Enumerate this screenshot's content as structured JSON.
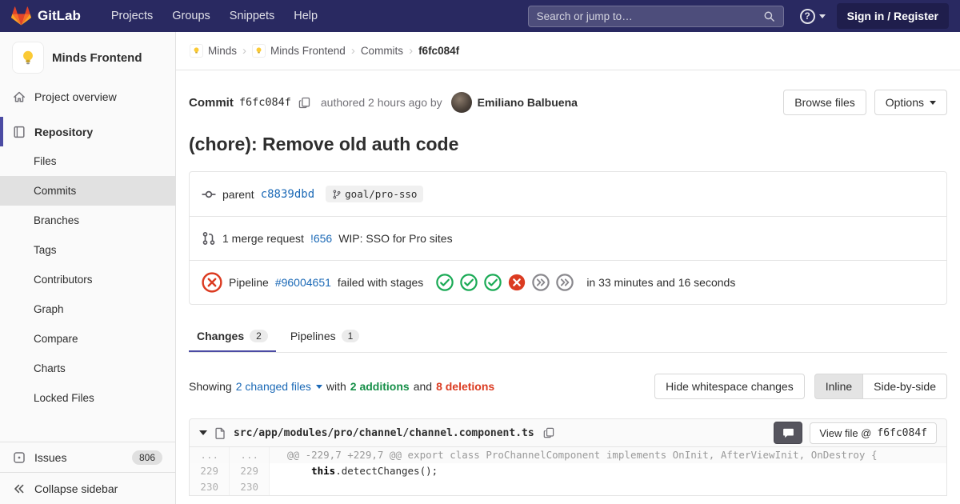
{
  "navbar": {
    "brand": "GitLab",
    "menu": [
      "Projects",
      "Groups",
      "Snippets",
      "Help"
    ],
    "search_placeholder": "Search or jump to…",
    "help_glyph": "?",
    "sign_in": "Sign in / Register"
  },
  "sidebar": {
    "project_name": "Minds Frontend",
    "avatar_icon": "lightbulb-icon",
    "overview": "Project overview",
    "section_label": "Repository",
    "items": [
      "Files",
      "Commits",
      "Branches",
      "Tags",
      "Contributors",
      "Graph",
      "Compare",
      "Charts",
      "Locked Files"
    ],
    "active_item": "Commits",
    "issues_label": "Issues",
    "issues_count": "806",
    "collapse_label": "Collapse sidebar"
  },
  "breadcrumb": {
    "group": "Minds",
    "project": "Minds Frontend",
    "section": "Commits",
    "current": "f6fc084f"
  },
  "commit": {
    "label": "Commit",
    "sha": "f6fc084f",
    "authored": "authored 2 hours ago by",
    "author": "Emiliano Balbuena",
    "browse_files": "Browse files",
    "options": "Options",
    "title": "(chore): Remove old auth code"
  },
  "details": {
    "parent_label": "parent",
    "parent_sha": "c8839dbd",
    "ref": "goal/pro-sso",
    "mr_count": "1 merge request",
    "mr_id": "!656",
    "mr_title": "WIP: SSO for Pro sites",
    "pipeline_label": "Pipeline",
    "pipeline_id": "#96004651",
    "pipeline_status_text": "failed with stages",
    "pipeline_stages": [
      "success",
      "success",
      "success",
      "failed",
      "skipped",
      "skipped"
    ],
    "pipeline_duration": "in 33 minutes and 16 seconds"
  },
  "tabs": {
    "changes_label": "Changes",
    "changes_count": "2",
    "pipelines_label": "Pipelines",
    "pipelines_count": "1"
  },
  "diff_toolbar": {
    "showing": "Showing",
    "changed_files": "2 changed files",
    "with_text": "with",
    "additions": "2 additions",
    "and_text": "and",
    "deletions": "8 deletions",
    "hide_whitespace": "Hide whitespace changes",
    "inline": "Inline",
    "side_by_side": "Side-by-side"
  },
  "diff_file": {
    "path": "src/app/modules/pro/channel/channel.component.ts",
    "view_file_prefix": "View file @",
    "view_file_sha": "f6fc084f",
    "lines": [
      {
        "old": "...",
        "new": "...",
        "type": "match",
        "code": "@@ -229,7 +229,7 @@ export class ProChannelComponent implements OnInit, AfterViewInit, OnDestroy {"
      },
      {
        "old": "229",
        "new": "229",
        "type": "context",
        "indent": "    ",
        "keyword": "this",
        "code": ".detectChanges();"
      },
      {
        "old": "230",
        "new": "230",
        "type": "context",
        "code": ""
      }
    ]
  },
  "colors": {
    "navbar_bg": "#292961",
    "link": "#1b69b6",
    "success": "#1aaa55",
    "failed": "#db3b21",
    "additions_text": "#168f48",
    "deletions_text": "#db3b21",
    "sidebar_accent": "#4b4ba3"
  }
}
